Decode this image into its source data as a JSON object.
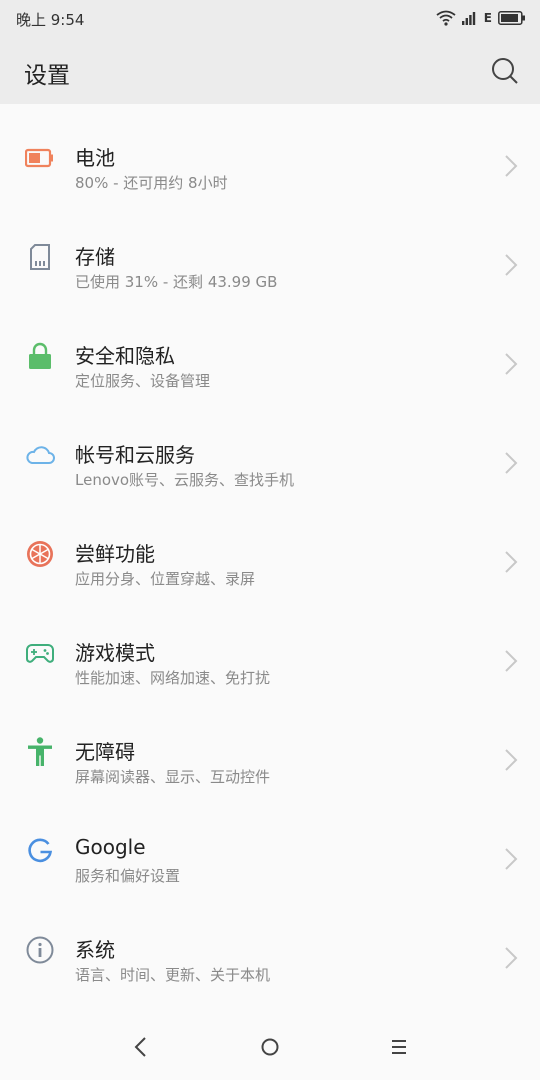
{
  "status": {
    "time": "晚上 9:54",
    "network": "E"
  },
  "header": {
    "title": "设置"
  },
  "items": [
    {
      "title": "电池",
      "subtitle": "80% - 还可用约 8小时",
      "icon": "battery-icon"
    },
    {
      "title": "存储",
      "subtitle": "已使用 31% - 还剩 43.99 GB",
      "icon": "storage-icon"
    },
    {
      "title": "安全和隐私",
      "subtitle": "定位服务、设备管理",
      "icon": "lock-icon"
    },
    {
      "title": "帐号和云服务",
      "subtitle": "Lenovo账号、云服务、查找手机",
      "icon": "cloud-icon"
    },
    {
      "title": "尝鲜功能",
      "subtitle": "应用分身、位置穿越、录屏",
      "icon": "orange-slice-icon"
    },
    {
      "title": "游戏模式",
      "subtitle": "性能加速、网络加速、免打扰",
      "icon": "gamepad-icon"
    },
    {
      "title": "无障碍",
      "subtitle": "屏幕阅读器、显示、互动控件",
      "icon": "accessibility-icon"
    },
    {
      "title": "Google",
      "subtitle": "服务和偏好设置",
      "icon": "google-icon"
    },
    {
      "title": "系统",
      "subtitle": "语言、时间、更新、关于本机",
      "icon": "info-icon"
    }
  ],
  "colors": {
    "battery": "#f0825c",
    "storage": "#7f8a99",
    "lock": "#5bbd6a",
    "cloud": "#6db3e8",
    "orange": "#e8735a",
    "gamepad": "#3fae7c",
    "accessibility": "#47b36a",
    "google": "#4a8fe0",
    "info": "#7f8a99"
  }
}
